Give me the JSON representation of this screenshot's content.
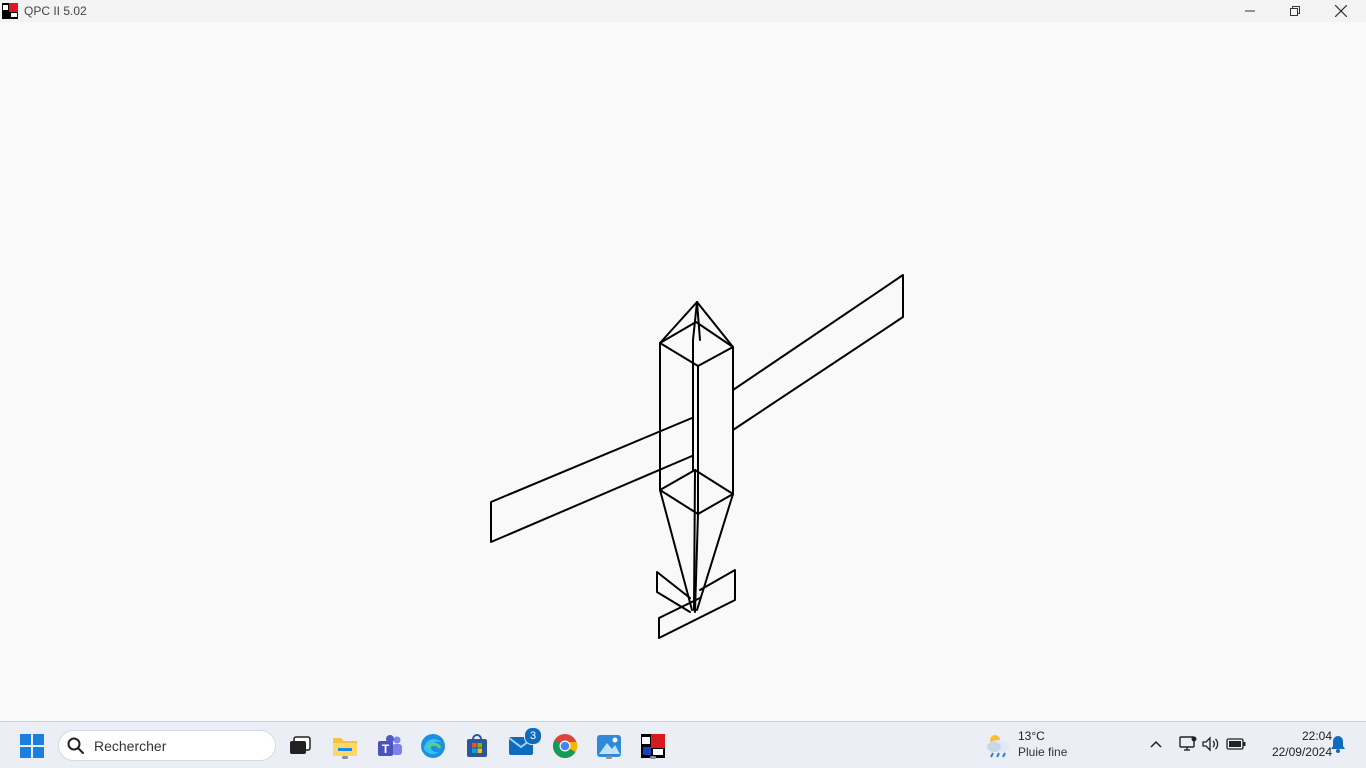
{
  "window": {
    "title": "QPC II 5.02",
    "minimize_icon": "minimize-icon",
    "restore_icon": "restore-icon",
    "close_icon": "close-icon"
  },
  "canvas": {
    "drawing": "wireframe-aircraft",
    "line_color": "#000000",
    "background": "#f9f9f9"
  },
  "taskbar": {
    "search_placeholder": "Rechercher",
    "apps": [
      {
        "name": "start",
        "icon": "windows-start-icon"
      },
      {
        "name": "task-view",
        "icon": "task-view-icon"
      },
      {
        "name": "file-explorer",
        "icon": "folder-icon",
        "running": true
      },
      {
        "name": "teams",
        "icon": "teams-icon"
      },
      {
        "name": "edge",
        "icon": "edge-icon"
      },
      {
        "name": "store",
        "icon": "store-icon"
      },
      {
        "name": "mail",
        "icon": "mail-icon",
        "badge": "3"
      },
      {
        "name": "chrome",
        "icon": "chrome-icon"
      },
      {
        "name": "photos",
        "icon": "photos-icon",
        "running": true
      },
      {
        "name": "qpc",
        "icon": "qpc-icon",
        "running": true
      }
    ],
    "weather": {
      "temperature": "13°C",
      "condition": "Pluie fine",
      "icon": "cloud-rain-icon"
    },
    "tray": {
      "chevron_icon": "chevron-up-icon",
      "network_icon": "network-icon",
      "volume_icon": "volume-icon",
      "battery_icon": "battery-icon",
      "notification_icon": "bell-icon"
    },
    "clock": {
      "time": "22:04",
      "date": "22/09/2024"
    },
    "accent_color": "#0f6cbd"
  }
}
